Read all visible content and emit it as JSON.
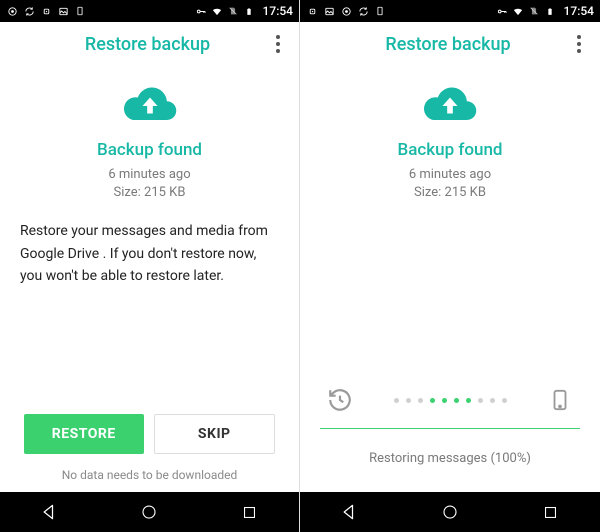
{
  "statusbar": {
    "clock": "17:54"
  },
  "appbar": {
    "title": "Restore backup"
  },
  "backup": {
    "heading": "Backup found",
    "age": "6 minutes ago",
    "size": "Size: 215 KB"
  },
  "left": {
    "description": "Restore your messages and media from Google Drive . If you don't restore now, you won't be able to restore later.",
    "restore_label": "RESTORE",
    "skip_label": "SKIP",
    "footnote": "No data needs to be downloaded"
  },
  "right": {
    "progress_label": "Restoring messages (100%)",
    "progress_percent": 100
  },
  "colors": {
    "accent": "#17b8a6",
    "primary_button": "#3bd16f"
  }
}
